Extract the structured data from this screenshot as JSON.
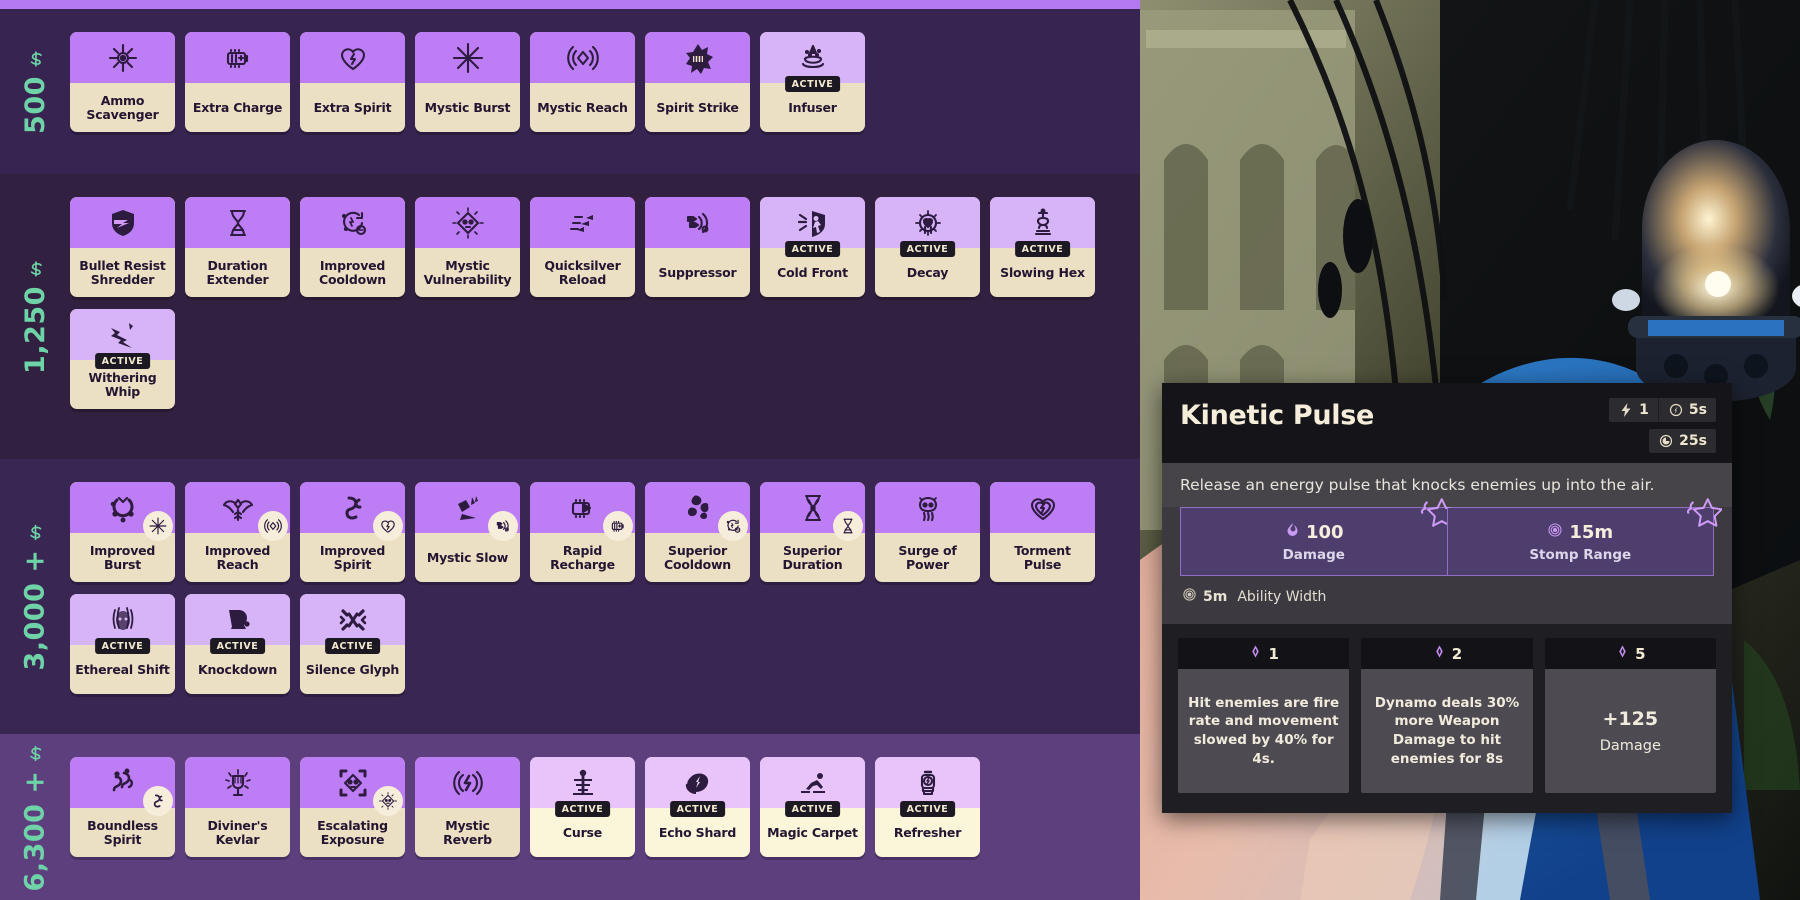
{
  "shop": {
    "tiers": [
      {
        "price": "500",
        "rows": [
          [
            {
              "name": "Ammo Scavenger",
              "icon": "ammo-scavenger-icon",
              "active": false
            },
            {
              "name": "Extra Charge",
              "icon": "extra-charge-icon",
              "active": false
            },
            {
              "name": "Extra Spirit",
              "icon": "extra-spirit-icon",
              "active": false
            },
            {
              "name": "Mystic Burst",
              "icon": "mystic-burst-icon",
              "active": false
            },
            {
              "name": "Mystic Reach",
              "icon": "mystic-reach-icon",
              "active": false
            },
            {
              "name": "Spirit Strike",
              "icon": "spirit-strike-icon",
              "active": false
            },
            {
              "name": "Infuser",
              "icon": "infuser-icon",
              "active": true
            }
          ]
        ]
      },
      {
        "price": "1,250",
        "rows": [
          [
            {
              "name": "Bullet Resist Shredder",
              "icon": "shield-shred-icon",
              "active": false
            },
            {
              "name": "Duration Extender",
              "icon": "hourglass-icon",
              "active": false
            },
            {
              "name": "Improved Cooldown",
              "icon": "cooldown-icon",
              "active": false
            },
            {
              "name": "Mystic Vulnerability",
              "icon": "skull-diamond-icon",
              "active": false
            },
            {
              "name": "Quicksilver Reload",
              "icon": "quick-reload-icon",
              "active": false
            },
            {
              "name": "Suppressor",
              "icon": "suppressor-icon",
              "active": false
            },
            {
              "name": "Cold Front",
              "icon": "cold-front-icon",
              "active": true
            },
            {
              "name": "Decay",
              "icon": "decay-icon",
              "active": true
            },
            {
              "name": "Slowing Hex",
              "icon": "slowing-hex-icon",
              "active": true
            }
          ],
          [
            {
              "name": "Withering Whip",
              "icon": "withering-whip-icon",
              "active": true
            }
          ]
        ]
      },
      {
        "price": "3,000 +",
        "rows": [
          [
            {
              "name": "Improved Burst",
              "icon": "improved-burst-icon",
              "active": false,
              "mini": "mystic-burst-icon"
            },
            {
              "name": "Improved Reach",
              "icon": "improved-reach-icon",
              "active": false,
              "mini": "mystic-reach-icon"
            },
            {
              "name": "Improved Spirit",
              "icon": "improved-spirit-icon",
              "active": false,
              "mini": "extra-spirit-icon"
            },
            {
              "name": "Mystic Slow",
              "icon": "mystic-slow-icon",
              "active": false,
              "mini": "suppressor-icon"
            },
            {
              "name": "Rapid Recharge",
              "icon": "rapid-recharge-icon",
              "active": false,
              "mini": "extra-charge-icon"
            },
            {
              "name": "Superior Cooldown",
              "icon": "superior-cooldown-icon",
              "active": false,
              "mini": "cooldown-icon"
            },
            {
              "name": "Superior Duration",
              "icon": "superior-duration-icon",
              "active": false,
              "mini": "hourglass-icon"
            },
            {
              "name": "Surge of Power",
              "icon": "surge-of-power-icon",
              "active": false
            },
            {
              "name": "Torment Pulse",
              "icon": "torment-pulse-icon",
              "active": false
            }
          ],
          [
            {
              "name": "Ethereal Shift",
              "icon": "ethereal-shift-icon",
              "active": true
            },
            {
              "name": "Knockdown",
              "icon": "knockdown-icon",
              "active": true
            },
            {
              "name": "Silence Glyph",
              "icon": "silence-glyph-icon",
              "active": true
            }
          ]
        ]
      },
      {
        "price": "6,300 +",
        "rows": [
          [
            {
              "name": "Boundless Spirit",
              "icon": "boundless-spirit-icon",
              "active": false,
              "mini": "improved-spirit-icon",
              "bright": false
            },
            {
              "name": "Diviner's Kevlar",
              "icon": "diviners-kevlar-icon",
              "active": false
            },
            {
              "name": "Escalating Exposure",
              "icon": "escalating-exposure-icon",
              "active": false,
              "mini": "skull-diamond-icon"
            },
            {
              "name": "Mystic Reverb",
              "icon": "mystic-reverb-icon",
              "active": false
            },
            {
              "name": "Curse",
              "icon": "curse-icon",
              "active": true,
              "bright": true
            },
            {
              "name": "Echo Shard",
              "icon": "echo-shard-icon",
              "active": true,
              "bright": true
            },
            {
              "name": "Magic Carpet",
              "icon": "magic-carpet-icon",
              "active": true,
              "bright": true
            },
            {
              "name": "Refresher",
              "icon": "refresher-icon",
              "active": true,
              "bright": true
            }
          ]
        ]
      }
    ],
    "active_badge_label": "ACTIVE"
  },
  "tooltip": {
    "title": "Kinetic Pulse",
    "chips_row1": [
      {
        "icon": "charges-icon",
        "value": "1"
      },
      {
        "icon": "charge-cooldown-icon",
        "value": "5s"
      }
    ],
    "chips_row2": [
      {
        "icon": "cooldown-clock-icon",
        "value": "25s"
      }
    ],
    "description": "Release an energy pulse that knocks enemies up into the air.",
    "stats": [
      {
        "icon": "damage-icon",
        "value": "100",
        "name": "Damage",
        "starred": true
      },
      {
        "icon": "range-icon",
        "value": "15m",
        "name": "Stomp Range",
        "starred": true
      }
    ],
    "extra_stats": [
      {
        "icon": "range-icon",
        "value": "5m",
        "name": "Ability Width"
      }
    ],
    "upgrades": [
      {
        "cost": "1",
        "text": "Hit enemies are fire rate and movement slowed by 40% for 4s.",
        "type": "text"
      },
      {
        "cost": "2",
        "text": "Dynamo deals 30% more Weapon Damage to hit enemies for 8s",
        "type": "text"
      },
      {
        "cost": "5",
        "type": "stat",
        "big": "+125",
        "sub": "Damage"
      }
    ]
  },
  "colors": {
    "accent_purple": "#bd7df5",
    "card_cream": "#ece0c4",
    "soul_green": "#6fd3a8",
    "tooltip_dark": "#17161a"
  }
}
